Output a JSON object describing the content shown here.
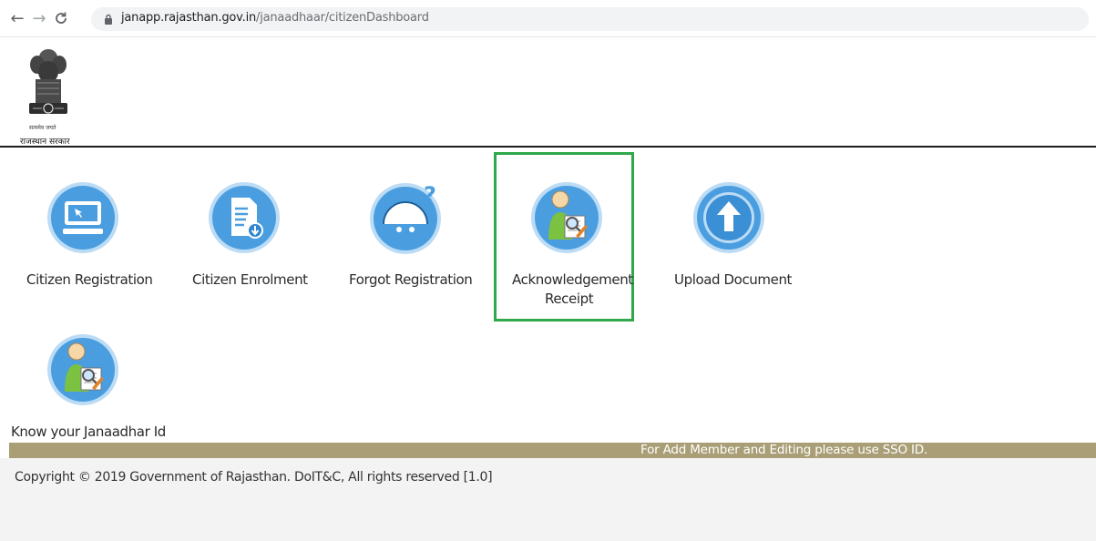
{
  "browser": {
    "url_host": "janapp.rajasthan.gov.in",
    "url_path": "/janaadhaar/citizenDashboard"
  },
  "header": {
    "emblem_motto": "सत्यमेव जयते",
    "emblem_caption": "राजस्थान सरकार"
  },
  "tiles": [
    {
      "label": "Citizen Registration",
      "icon": "computer-icon"
    },
    {
      "label": "Citizen Enrolment",
      "icon": "document-icon"
    },
    {
      "label": "Forgot Registration",
      "icon": "question-face-icon"
    },
    {
      "label_line1": "Acknowledgement",
      "label_line2": "Receipt",
      "icon": "user-search-icon"
    },
    {
      "label": "Upload Document",
      "icon": "upload-arrow-icon"
    },
    {
      "label": "Know your Janaadhar Id",
      "icon": "user-search-icon"
    }
  ],
  "notice": {
    "text": "For Add Member and Editing please use SSO ID."
  },
  "footer": {
    "copyright": "Copyright © 2019 Government of Rajasthan. DoIT&C, All rights reserved [1.0]"
  },
  "colors": {
    "highlight": "#2ea84a",
    "notice_bar": "#a99e76",
    "icon_circle": "#4a9ee0"
  }
}
